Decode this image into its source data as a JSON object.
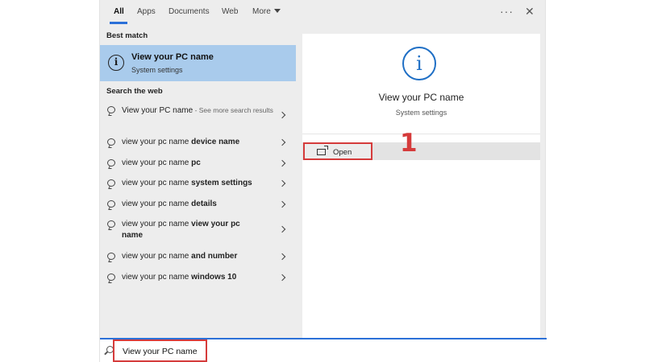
{
  "tabs": [
    {
      "label": "All",
      "active": true
    },
    {
      "label": "Apps"
    },
    {
      "label": "Documents"
    },
    {
      "label": "Web"
    },
    {
      "label": "More"
    }
  ],
  "top_right": {
    "more_options": "···",
    "close": "✕"
  },
  "best_match": {
    "section_title": "Best match",
    "title": "View your PC name",
    "subtitle": "System settings",
    "icon": "info-icon"
  },
  "web": {
    "section_title": "Search the web",
    "items": [
      {
        "prefix": "View your PC name",
        "bold": "",
        "suffix": " - See more search results"
      },
      {
        "prefix": "view your pc name ",
        "bold": "device name",
        "suffix": ""
      },
      {
        "prefix": "view your pc name ",
        "bold": "pc",
        "suffix": ""
      },
      {
        "prefix": "view your pc name ",
        "bold": "system settings",
        "suffix": ""
      },
      {
        "prefix": "view your pc name ",
        "bold": "details",
        "suffix": ""
      },
      {
        "prefix": "view your pc name ",
        "bold": "view your pc name",
        "suffix": ""
      },
      {
        "prefix": "view your pc name ",
        "bold": "and number",
        "suffix": ""
      },
      {
        "prefix": "view your pc name ",
        "bold": "windows 10",
        "suffix": ""
      }
    ]
  },
  "preview": {
    "icon_glyph": "i",
    "title": "View your PC name",
    "subtitle": "System settings",
    "open_label": "Open",
    "step_number": "1"
  },
  "search": {
    "value": "View your PC name"
  },
  "colors": {
    "accent": "#2b70d8",
    "highlight": "#a9cbec",
    "annotation": "#d53b3b",
    "info_icon": "#1f6fc5"
  }
}
